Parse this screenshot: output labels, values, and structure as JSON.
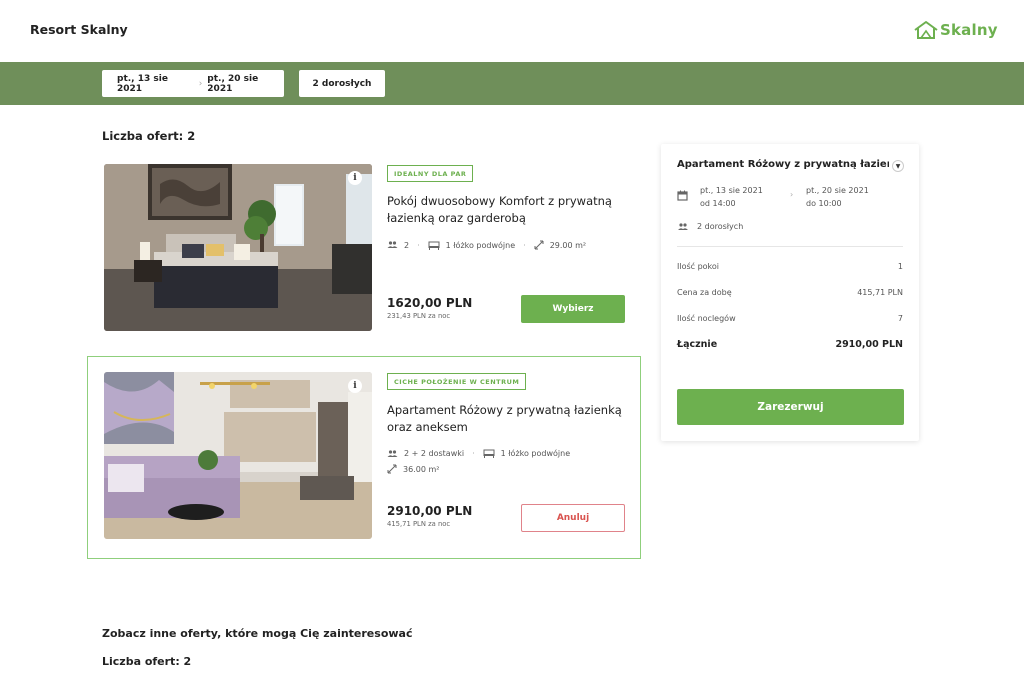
{
  "header": {
    "brand": "Resort Skalny",
    "logo_text": "Skalny",
    "accent_color": "#6db04f",
    "bar_color": "#6f8f5a"
  },
  "search": {
    "date_from": "pt., 13 sie 2021",
    "date_to": "pt., 20 sie 2021",
    "guests": "2 dorosłych"
  },
  "results": {
    "count_label": "Liczba ofert: 2",
    "offers": [
      {
        "tag": "IDEALNY DLA PAR",
        "title": "Pokój dwuosobowy Komfort z prywatną łazienką oraz garderobą",
        "guests": "2",
        "beds": "1 łóżko podwójne",
        "area": "29.00 m²",
        "price": "1620,00 PLN",
        "per_night": "231,43 PLN za noc",
        "action": "Wybierz",
        "selected": false
      },
      {
        "tag": "CICHE POŁOŻENIE W CENTRUM",
        "title": "Apartament Różowy z prywatną łazienką oraz aneksem",
        "guests": "2 + 2 dostawki",
        "beds": "1 łóżko podwójne",
        "area": "36.00 m²",
        "price": "2910,00 PLN",
        "per_night": "415,71 PLN za noc",
        "action": "Anuluj",
        "selected": true
      }
    ]
  },
  "summary": {
    "title": "Apartament Różowy z prywatną łazienką oraz aneksem",
    "checkin_date": "pt., 13 sie 2021",
    "checkin_time": "od 14:00",
    "checkout_date": "pt., 20 sie 2021",
    "checkout_time": "do 10:00",
    "guests": "2 dorosłych",
    "rows": [
      {
        "label": "Ilość pokoi",
        "value": "1"
      },
      {
        "label": "Cena za dobę",
        "value": "415,71 PLN"
      },
      {
        "label": "Ilość noclegów",
        "value": "7"
      }
    ],
    "total_label": "Łącznie",
    "total_value": "2910,00 PLN",
    "book_button": "Zarezerwuj"
  },
  "other": {
    "heading": "Zobacz inne oferty, które mogą Cię zainteresować",
    "count_label": "Liczba ofert: 2"
  }
}
